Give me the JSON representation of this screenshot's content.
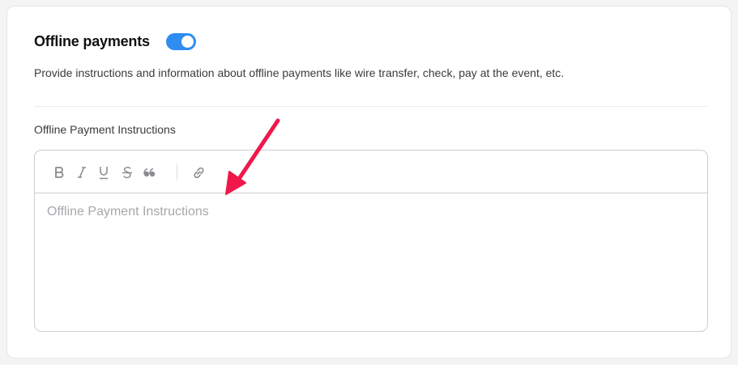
{
  "section": {
    "title": "Offline payments",
    "toggle_on": true,
    "description": "Provide instructions and information about offline payments like wire transfer, check, pay at the event, etc."
  },
  "field": {
    "label": "Offline Payment Instructions",
    "placeholder": "Offline Payment Instructions",
    "value": ""
  },
  "toolbar": {
    "buttons": [
      "bold-icon",
      "italic-icon",
      "underline-icon",
      "strikethrough-icon",
      "quote-icon",
      "link-icon"
    ]
  },
  "colors": {
    "toggle_on": "#2f8cf0",
    "annotation_arrow": "#f0184a"
  }
}
